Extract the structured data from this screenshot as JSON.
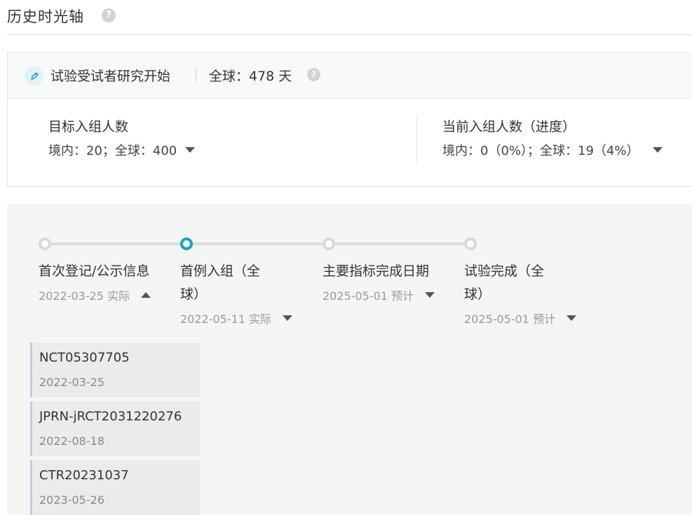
{
  "page": {
    "title": "历史时光轴",
    "help_glyph": "?"
  },
  "study": {
    "label": "试验受试者研究开始",
    "global_days": "全球：478 天",
    "help_glyph": "?"
  },
  "enrollment": {
    "target_title": "目标入组人数",
    "target_value": "境内：20；全球：400",
    "current_title": "当前入组人数（进度）",
    "current_value": "境内：0（0%）；全球：19（4%）"
  },
  "timeline": {
    "active_color": "#16a3c4",
    "milestones": [
      {
        "title": "首次登记/公示信息",
        "date": "2022-03-25 实际",
        "expanded": true
      },
      {
        "title": "首例入组（全球）",
        "date": "2022-05-11 实际",
        "expanded": false
      },
      {
        "title": "主要指标完成日期",
        "date": "2025-05-01 预计",
        "expanded": false
      },
      {
        "title": "试验完成（全球）",
        "date": "2025-05-01 预计",
        "expanded": false
      }
    ],
    "registrations": [
      {
        "id": "NCT05307705",
        "date": "2022-03-25"
      },
      {
        "id": "JPRN-jRCT2031220276",
        "date": "2022-08-18"
      },
      {
        "id": "CTR20231037",
        "date": "2023-05-26"
      }
    ]
  }
}
